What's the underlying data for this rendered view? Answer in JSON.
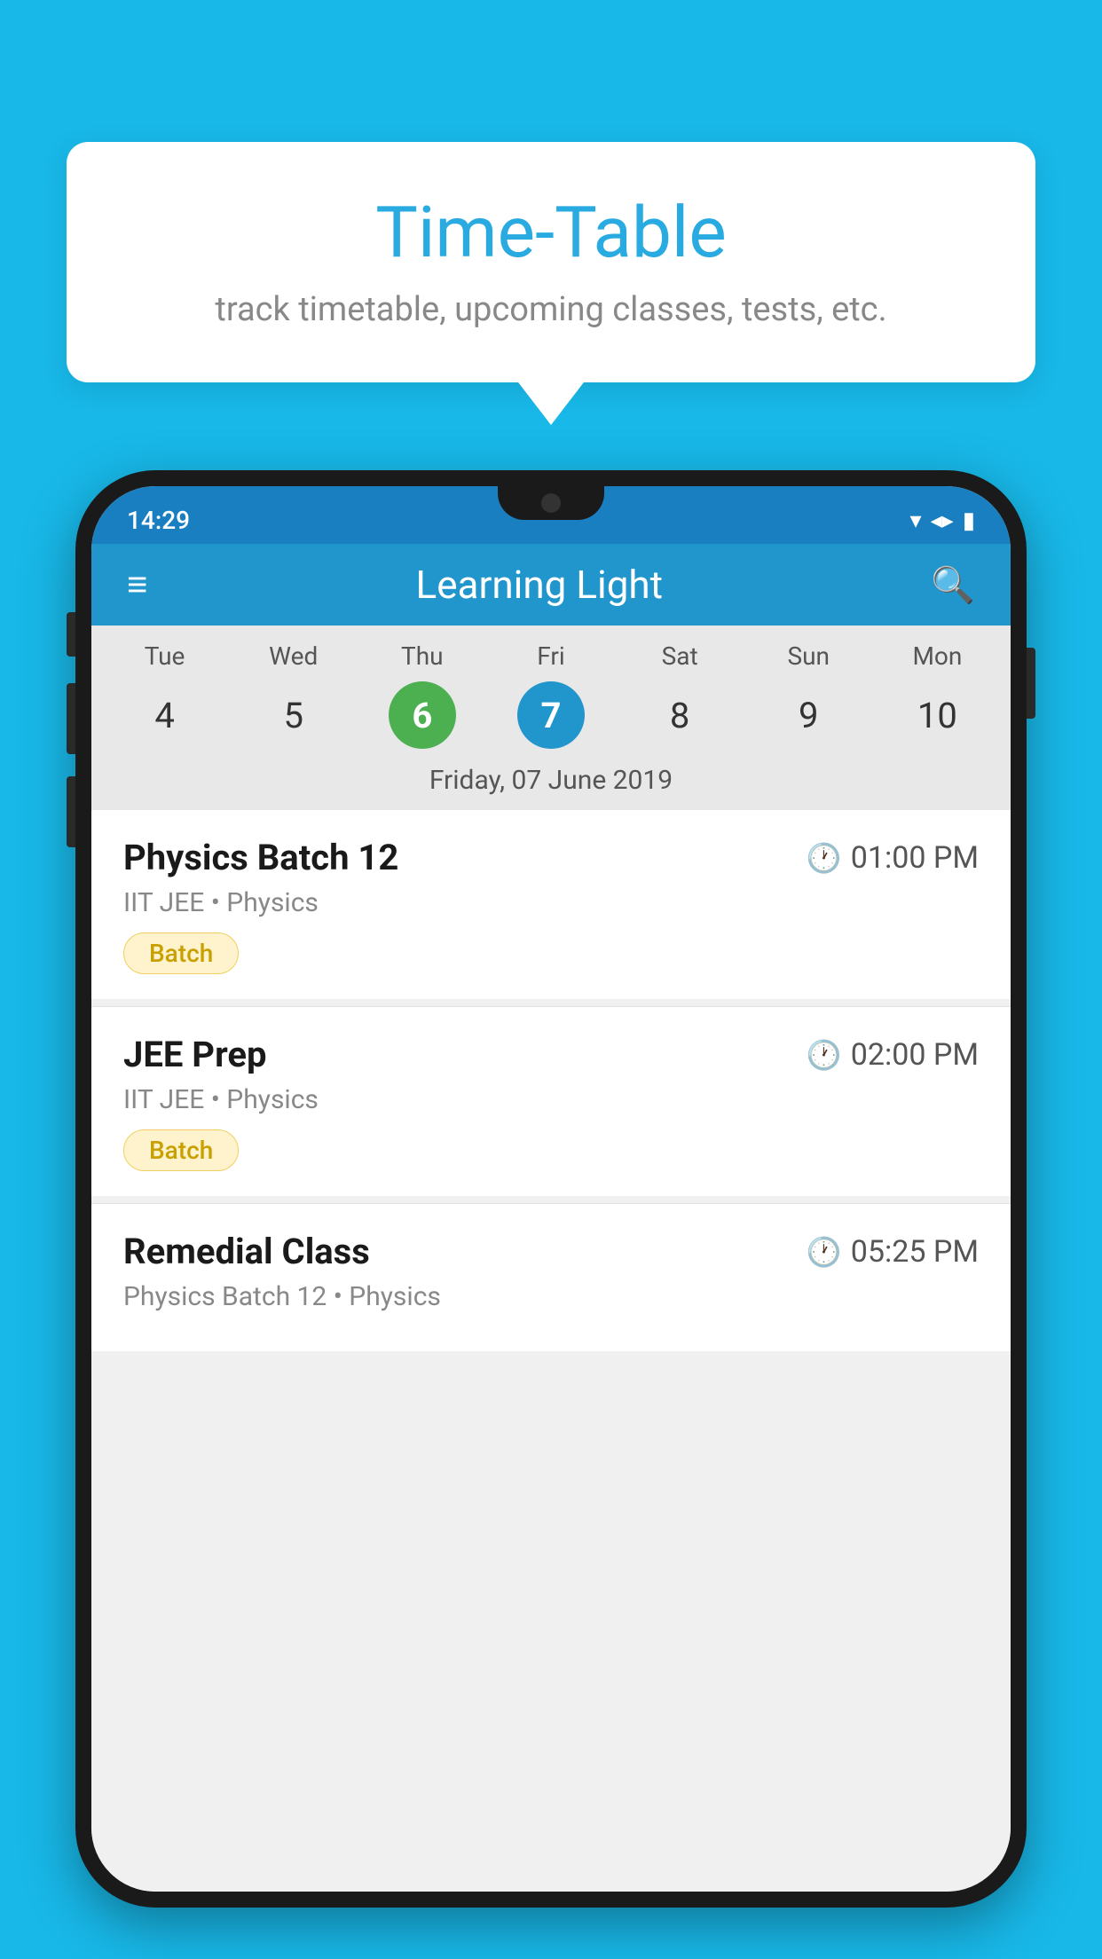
{
  "background_color": "#18b8e8",
  "speech_bubble": {
    "title": "Time-Table",
    "subtitle": "track timetable, upcoming classes, tests, etc."
  },
  "phone": {
    "status_bar": {
      "time": "14:29"
    },
    "app_bar": {
      "title": "Learning Light",
      "hamburger_label": "≡",
      "search_label": "🔍"
    },
    "calendar": {
      "days": [
        "Tue",
        "Wed",
        "Thu",
        "Fri",
        "Sat",
        "Sun",
        "Mon"
      ],
      "dates": [
        {
          "num": "4",
          "state": "normal"
        },
        {
          "num": "5",
          "state": "normal"
        },
        {
          "num": "6",
          "state": "today"
        },
        {
          "num": "7",
          "state": "selected"
        },
        {
          "num": "8",
          "state": "normal"
        },
        {
          "num": "9",
          "state": "normal"
        },
        {
          "num": "10",
          "state": "normal"
        }
      ],
      "selected_date_label": "Friday, 07 June 2019"
    },
    "events": [
      {
        "name": "Physics Batch 12",
        "time": "01:00 PM",
        "meta": "IIT JEE • Physics",
        "badge": "Batch"
      },
      {
        "name": "JEE Prep",
        "time": "02:00 PM",
        "meta": "IIT JEE • Physics",
        "badge": "Batch"
      },
      {
        "name": "Remedial Class",
        "time": "05:25 PM",
        "meta": "Physics Batch 12 • Physics",
        "badge": ""
      }
    ]
  }
}
